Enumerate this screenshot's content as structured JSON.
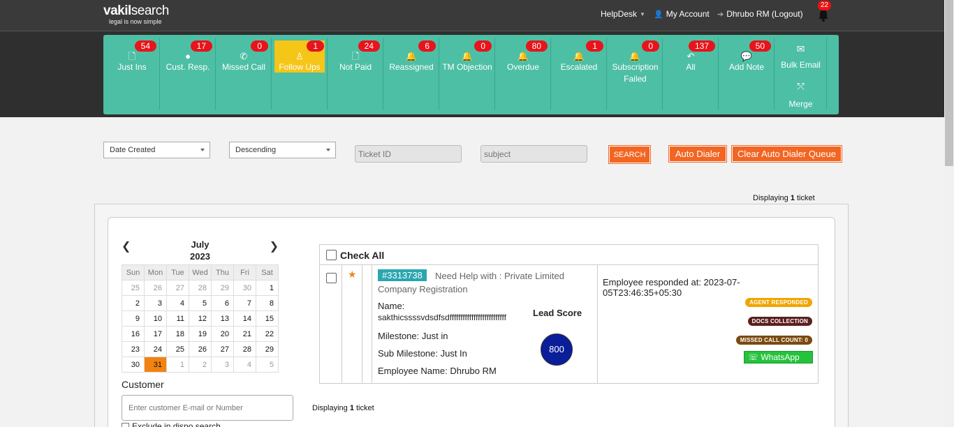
{
  "brand": {
    "logo_main": "vakil",
    "logo_rest": "search",
    "tagline": "legal is now simple"
  },
  "topnav": {
    "helpdesk": "HelpDesk",
    "account": "My Account",
    "logout": "Dhrubo RM (Logout)",
    "notifications": "22"
  },
  "tabs": [
    {
      "label": "Just Ins",
      "count": "54",
      "icon": "file-icon"
    },
    {
      "label": "Cust. Resp.",
      "count": "17",
      "icon": "user-icon"
    },
    {
      "label": "Missed Call",
      "count": "0",
      "icon": "phone-icon"
    },
    {
      "label": "Follow Ups",
      "count": "1",
      "icon": "person-icon",
      "active": true
    },
    {
      "label": "Not Paid",
      "count": "24",
      "icon": "file-icon"
    },
    {
      "label": "Reassigned",
      "count": "6",
      "icon": "bell-icon"
    },
    {
      "label": "TM Objection",
      "count": "0",
      "icon": "bell-icon"
    },
    {
      "label": "Overdue",
      "count": "80",
      "icon": "bell-icon"
    },
    {
      "label": "Escalated",
      "count": "1",
      "icon": "bell-icon"
    },
    {
      "label": "Subscription Failed",
      "count": "0",
      "icon": "bell-icon"
    },
    {
      "label": "All",
      "count": "137",
      "icon": "reply-icon"
    },
    {
      "label": "Add Note",
      "count": "50",
      "icon": "comment-icon"
    }
  ],
  "actions": {
    "bulk_email": "Bulk Email",
    "merge": "Merge"
  },
  "filters": {
    "sort_field": "Date Created",
    "sort_order": "Descending",
    "ticket_id_placeholder": "Ticket ID",
    "subject_placeholder": "subject",
    "search": "SEARCH",
    "auto_dialer": "Auto Dialer",
    "clear_queue": "Clear Auto Dialer Queue"
  },
  "display": {
    "prefix": "Displaying",
    "count": "1",
    "suffix": "ticket"
  },
  "calendar": {
    "month": "July",
    "year": "2023",
    "weekdays": [
      "Sun",
      "Mon",
      "Tue",
      "Wed",
      "Thu",
      "Fri",
      "Sat"
    ],
    "weeks": [
      [
        "25",
        "26",
        "27",
        "28",
        "29",
        "30",
        "1"
      ],
      [
        "2",
        "3",
        "4",
        "5",
        "6",
        "7",
        "8"
      ],
      [
        "9",
        "10",
        "11",
        "12",
        "13",
        "14",
        "15"
      ],
      [
        "16",
        "17",
        "18",
        "19",
        "20",
        "21",
        "22"
      ],
      [
        "23",
        "24",
        "25",
        "26",
        "27",
        "28",
        "29"
      ],
      [
        "30",
        "31",
        "1",
        "2",
        "3",
        "4",
        "5"
      ]
    ],
    "selected": "31"
  },
  "customer": {
    "label": "Customer",
    "placeholder": "Enter customer E-mail or Number",
    "exclude_label": "Exclude in dispo search"
  },
  "table": {
    "check_all": "Check All"
  },
  "ticket": {
    "id": "#3313738",
    "subject": "Need Help with : Private Limited Company Registration",
    "name_label": "Name:",
    "name_value": "sakthicssssvdsdfsdffffffffffffffffffffffffff",
    "milestone": "Milestone: Just in",
    "sub_milestone": "Sub Milestone: Just In",
    "employee": "Employee Name: Dhrubo RM",
    "lead_score_label": "Lead Score",
    "lead_score": "800",
    "responded": "Employee responded at: 2023-07-05T23:46:35+05:30",
    "badges": [
      {
        "text": "AGENT RESPONDED",
        "color": "#f0a500"
      },
      {
        "text": "DOCS COLLECTION",
        "color": "#5b1f1f"
      },
      {
        "text": "MISSED CALL COUNT: 0",
        "color": "#7a4a10"
      }
    ],
    "whatsapp": "WhatsApp Me!"
  },
  "colors": {
    "tab_green": "#4dbfa5",
    "active_tab": "#f5c518",
    "badge_red": "#e8141b",
    "orange": "#f26522"
  }
}
